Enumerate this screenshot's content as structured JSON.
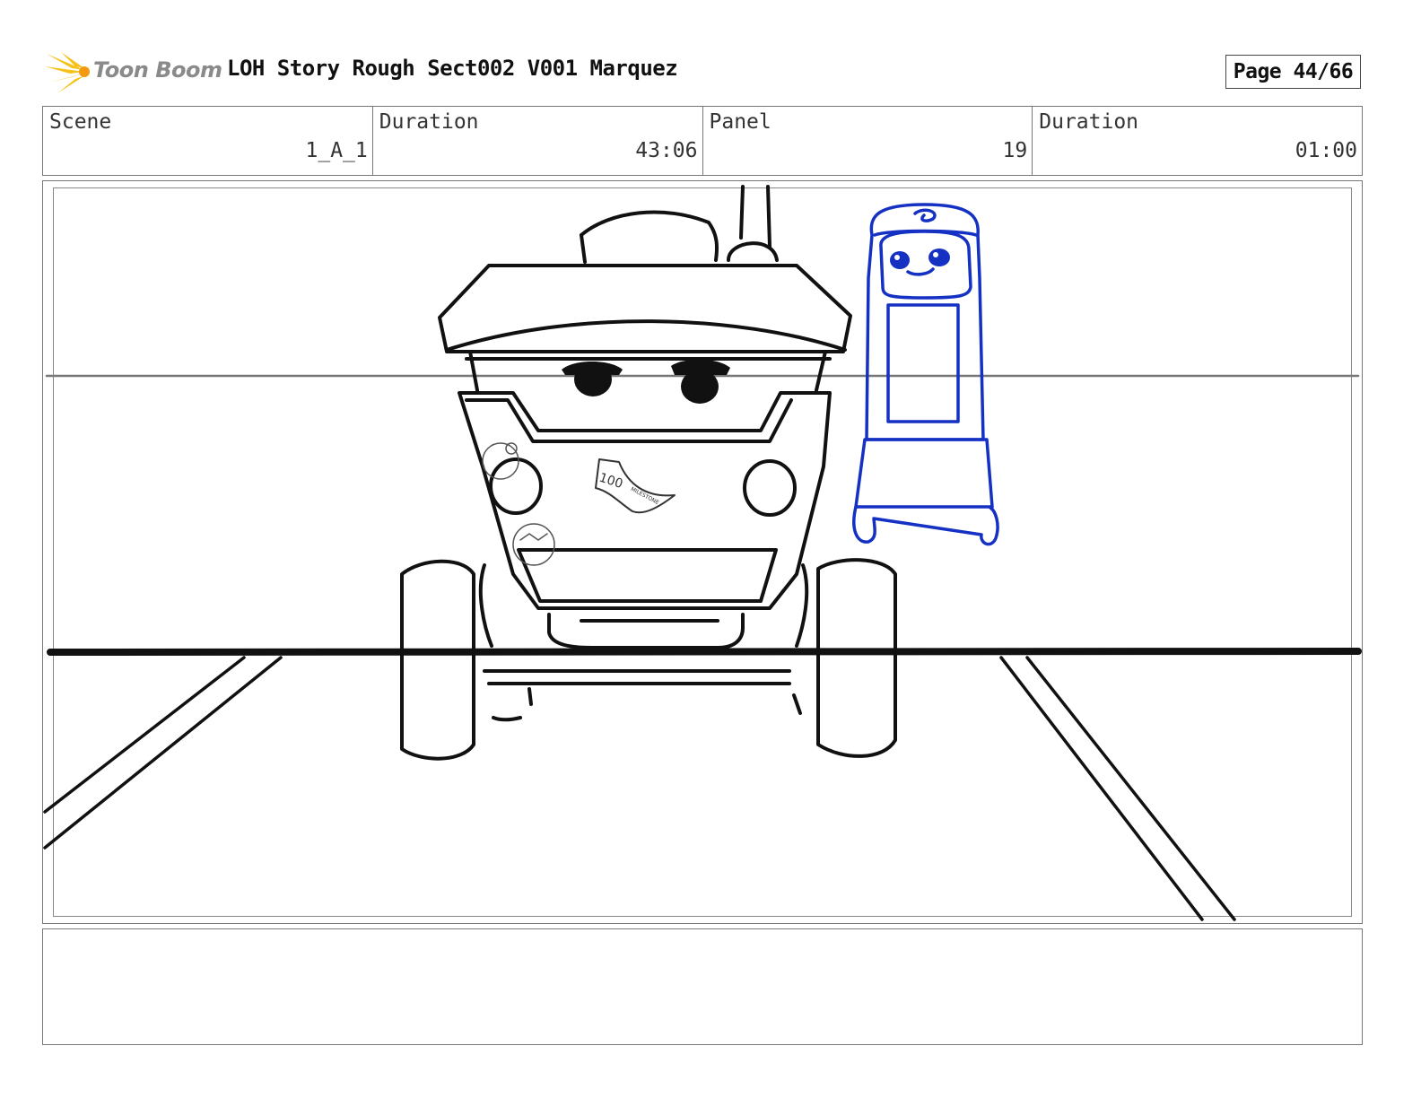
{
  "header": {
    "logo_text": "Toon Boom",
    "title": "LOH Story Rough Sect002 V001 Marquez",
    "page": "Page 44/66"
  },
  "info": {
    "scene_label": "Scene",
    "scene_value": "1_A_1",
    "duration_label": "Duration",
    "duration_value": "43:06",
    "panel_label": "Panel",
    "panel_value": "19",
    "panel_duration_label": "Duration",
    "panel_duration_value": "01:00"
  },
  "panel": {
    "sign_text": "100",
    "sign_subtext": "MILESTONE",
    "colors": {
      "sketch": "#111111",
      "blue_character": "#1531c4",
      "guide_line": "#777777"
    }
  },
  "notes": {
    "text": ""
  }
}
